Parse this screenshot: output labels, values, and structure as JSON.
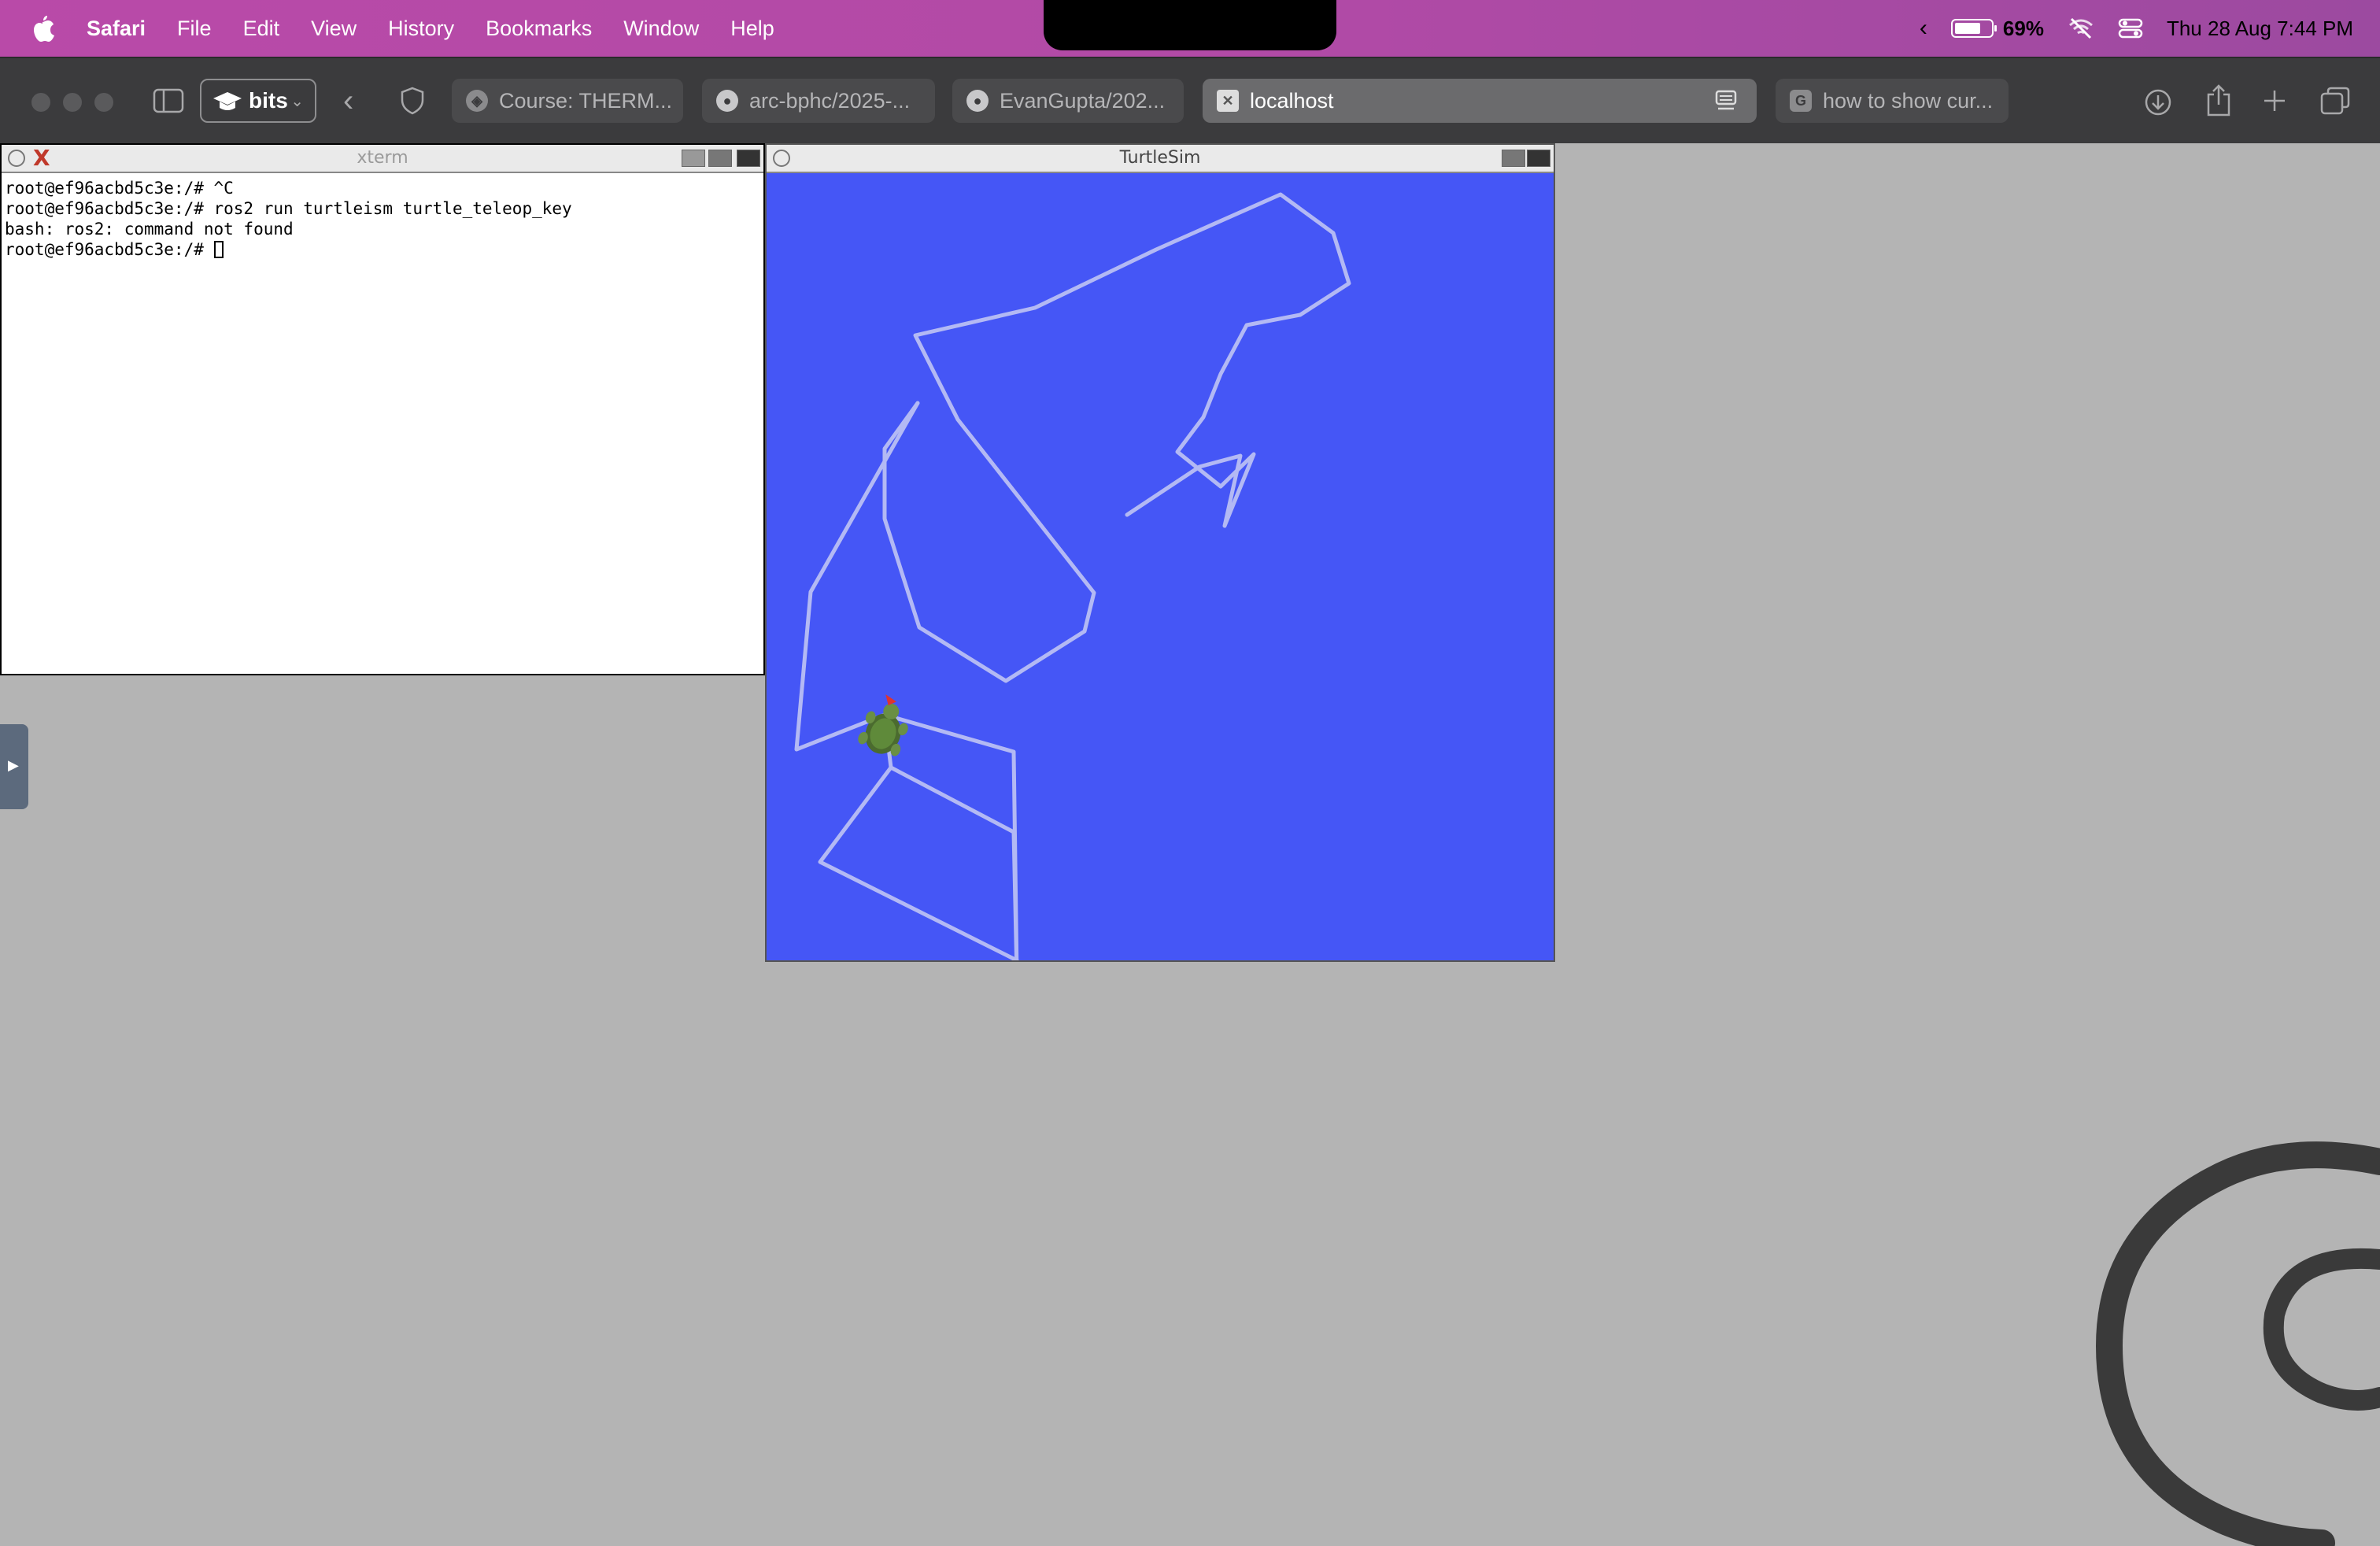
{
  "menubar": {
    "app_name": "Safari",
    "items": [
      "File",
      "Edit",
      "View",
      "History",
      "Bookmarks",
      "Window",
      "Help"
    ],
    "battery_percent": "69%",
    "datetime": "Thu 28 Aug  7:44 PM"
  },
  "toolbar": {
    "profile_label": "bits",
    "tabs": [
      {
        "label": "Course: THERM...",
        "favicon": "shield-icon"
      },
      {
        "label": "arc-bphc/2025-...",
        "favicon": "github-icon"
      },
      {
        "label": "EvanGupta/202...",
        "favicon": "github-icon"
      },
      {
        "label": "localhost",
        "favicon": "x-window-icon",
        "active": true
      },
      {
        "label": "how to show cur...",
        "favicon": "google-icon",
        "favicon_letter": "G"
      }
    ]
  },
  "xterm": {
    "title": "xterm",
    "lines": [
      "root@ef96acbd5c3e:/# ^C",
      "root@ef96acbd5c3e:/# ros2 run turtleism turtle_teleop_key",
      "bash: ros2: command not found",
      "root@ef96acbd5c3e:/# "
    ]
  },
  "turtlesim": {
    "title": "TurtleSim",
    "background_color": "#4556f6",
    "pen_color": "#b3b9f4"
  }
}
